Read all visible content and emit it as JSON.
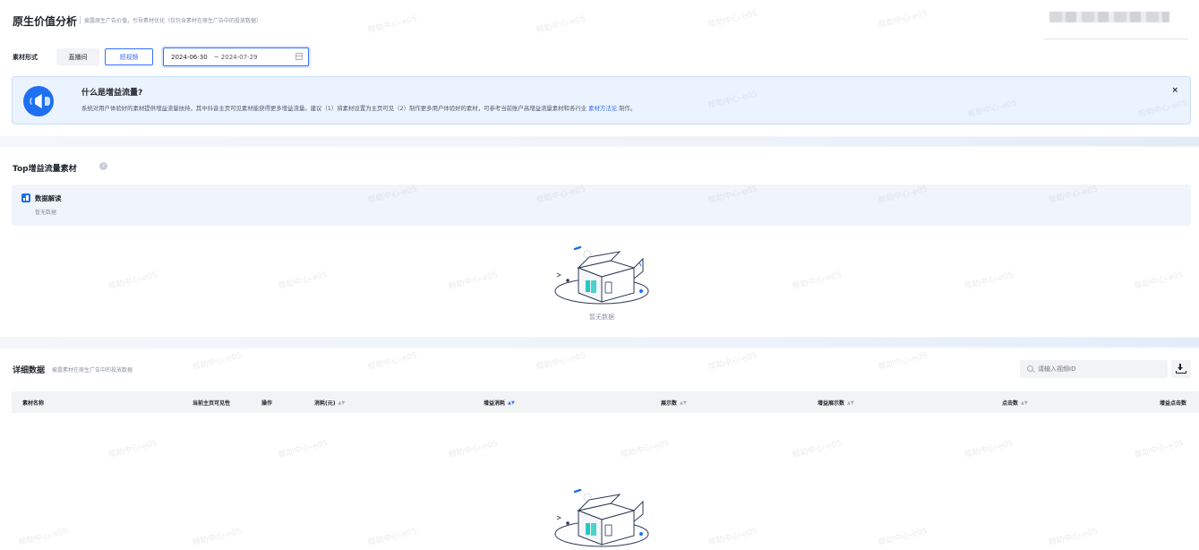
{
  "header": {
    "title": "原生价值分析",
    "subtitle": "披露原生广告价值，引导素材优化（仅包含素材在原生广告中的投放数据）"
  },
  "filters": {
    "label": "素材形式",
    "options": [
      "直播间",
      "短视频"
    ],
    "selected": "短视频",
    "date_start": "2024-06-30",
    "date_sep": "~",
    "date_end": "2024-07-29"
  },
  "banner": {
    "title": "什么是增益流量?",
    "text": "系统对用户体验好的素材提供增益流量扶持，其中抖音主页可见素材能获得更多增益流量。建议（1）将素材设置为主页可见（2）制作更多用户体验好的素材，可参考当前账户高增益流量素材和各行业 ",
    "link": "素材方法论",
    "text_after": " 制作。",
    "close": "×"
  },
  "top_section": {
    "title": "Top增益流量素材",
    "insight_title": "数据解读",
    "insight_empty": "暂无数据",
    "empty_text": "暂无数据"
  },
  "detail_section": {
    "title": "详细数据",
    "subtitle": "披露素材在原生广告中的投放数据",
    "search_placeholder": "请输入视频ID",
    "columns": [
      {
        "label": "素材名称",
        "sortable": false
      },
      {
        "label": "当前主页可见性",
        "sortable": false
      },
      {
        "label": "操作",
        "sortable": false
      },
      {
        "label": "消耗(元)",
        "sortable": true,
        "active": false
      },
      {
        "label": "增益消耗",
        "sortable": true,
        "active": true
      },
      {
        "label": "展示数",
        "sortable": true,
        "active": false
      },
      {
        "label": "增益展示数",
        "sortable": true,
        "active": false
      },
      {
        "label": "点击数",
        "sortable": true,
        "active": false
      },
      {
        "label": "增益点击数",
        "sortable": false,
        "active": false
      }
    ]
  },
  "watermark": "帮助中心-e05",
  "colors": {
    "accent": "#3370ff",
    "banner_bg": "#ebf3ff",
    "illustration_teal": "#22c9c0"
  }
}
